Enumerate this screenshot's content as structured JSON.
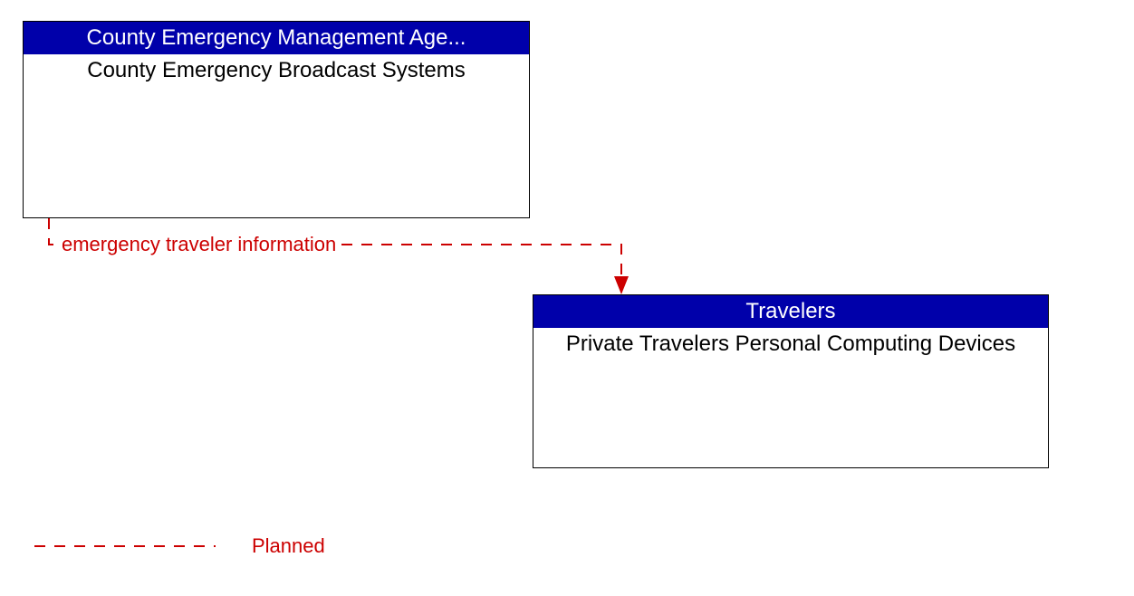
{
  "boxes": {
    "box1": {
      "header": "County Emergency Management Age...",
      "body": "County Emergency Broadcast Systems"
    },
    "box2": {
      "header": "Travelers",
      "body": "Private Travelers Personal Computing Devices"
    }
  },
  "flows": {
    "flow1": {
      "label": "emergency traveler information"
    }
  },
  "legend": {
    "planned": "Planned"
  },
  "colors": {
    "header_bg": "#0000aa",
    "header_text": "#ffffff",
    "flow": "#cc0000",
    "border": "#000000"
  }
}
